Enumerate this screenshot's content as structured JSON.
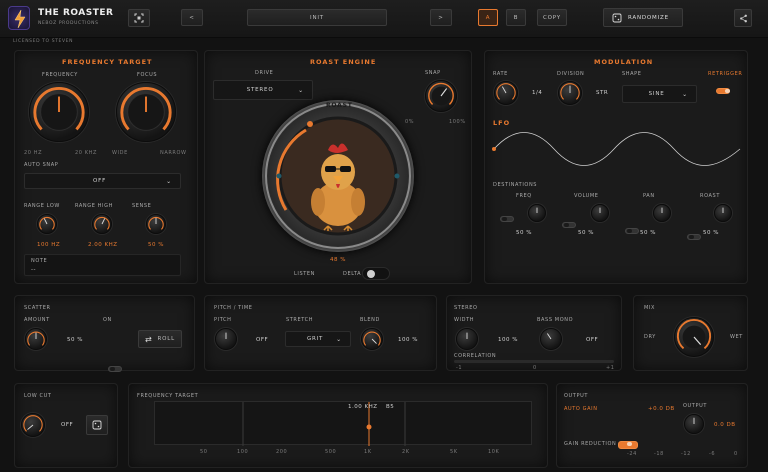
{
  "header": {
    "app_title": "THE ROASTER",
    "vendor": "NEBOZ PRODUCTIONS",
    "license": "LICENSED TO STEVEN",
    "preset_name": "INIT",
    "prev_label": "<",
    "next_label": ">",
    "ab_a": "A",
    "ab_b": "B",
    "copy_label": "COPY",
    "randomize_label": "RANDOMIZE",
    "accent_color": "#e8792f"
  },
  "frequency_target": {
    "title": "FREQUENCY TARGET",
    "frequency_label": "FREQUENCY",
    "focus_label": "FOCUS",
    "freq_min": "20 HZ",
    "freq_max": "20 KHZ",
    "focus_min": "WIDE",
    "focus_max": "NARROW",
    "auto_snap_label": "AUTO SNAP",
    "auto_snap_value": "OFF",
    "range_low_label": "RANGE LOW",
    "range_high_label": "RANGE HIGH",
    "sense_label": "SENSE",
    "range_low_value": "100 HZ",
    "range_high_value": "2.00 KHZ",
    "sense_value": "50 %",
    "note_label": "NOTE",
    "note_value": "--"
  },
  "roast_engine": {
    "title": "ROAST ENGINE",
    "drive_label": "DRIVE",
    "drive_value": "STEREO",
    "snap_label": "SNAP",
    "snap_min": "0%",
    "snap_max": "100%",
    "dial_label": "ROAST",
    "amount_value": "48 %",
    "listen_label": "LISTEN",
    "delta_label": "DELTA"
  },
  "modulation": {
    "title": "MODULATION",
    "rate_label": "RATE",
    "division_label": "DIVISION",
    "shape_label": "SHAPE",
    "retrigger_label": "RETRIGGER",
    "division_value": "1/4",
    "str_value": "STR",
    "shape_value": "SINE",
    "lfo_label": "LFO",
    "destinations_label": "DESTINATIONS",
    "destinations": [
      {
        "name": "FREQ",
        "value": "50 %"
      },
      {
        "name": "VOLUME",
        "value": "50 %"
      },
      {
        "name": "PAN",
        "value": "50 %"
      },
      {
        "name": "ROAST",
        "value": "50 %"
      }
    ]
  },
  "scatter": {
    "title": "SCATTER",
    "amount_label": "AMOUNT",
    "on_label": "ON",
    "amount_value": "50 %",
    "roll_label": "ROLL"
  },
  "pitch_time": {
    "title": "PITCH / TIME",
    "pitch_label": "PITCH",
    "stretch_label": "STRETCH",
    "blend_label": "BLEND",
    "pitch_value": "OFF",
    "stretch_value": "GRIT",
    "blend_value": "100 %"
  },
  "stereo": {
    "title": "STEREO",
    "width_label": "WIDTH",
    "bass_mono_label": "BASS MONO",
    "width_value": "100 %",
    "bass_mono_value": "OFF",
    "correlation_label": "CORRELATION",
    "corr_min": "-1",
    "corr_mid": "0",
    "corr_max": "+1"
  },
  "mix": {
    "title": "MIX",
    "dry_label": "DRY",
    "wet_label": "WET"
  },
  "low_cut": {
    "title": "LOW CUT",
    "value": "OFF"
  },
  "freq_display": {
    "title": "FREQUENCY TARGET",
    "readout_freq": "1.00 KHZ",
    "readout_note": "B5",
    "ticks": [
      "50",
      "100",
      "200",
      "500",
      "1K",
      "2K",
      "5K",
      "10K"
    ]
  },
  "output": {
    "title": "OUTPUT",
    "auto_gain_label": "AUTO GAIN",
    "auto_gain_value": "+0.0 DB",
    "output_label": "OUTPUT",
    "output_value": "0.0 DB",
    "gain_reduction_label": "GAIN REDUCTION",
    "gr_ticks": [
      "-24",
      "-18",
      "-12",
      "-6",
      "0"
    ]
  }
}
